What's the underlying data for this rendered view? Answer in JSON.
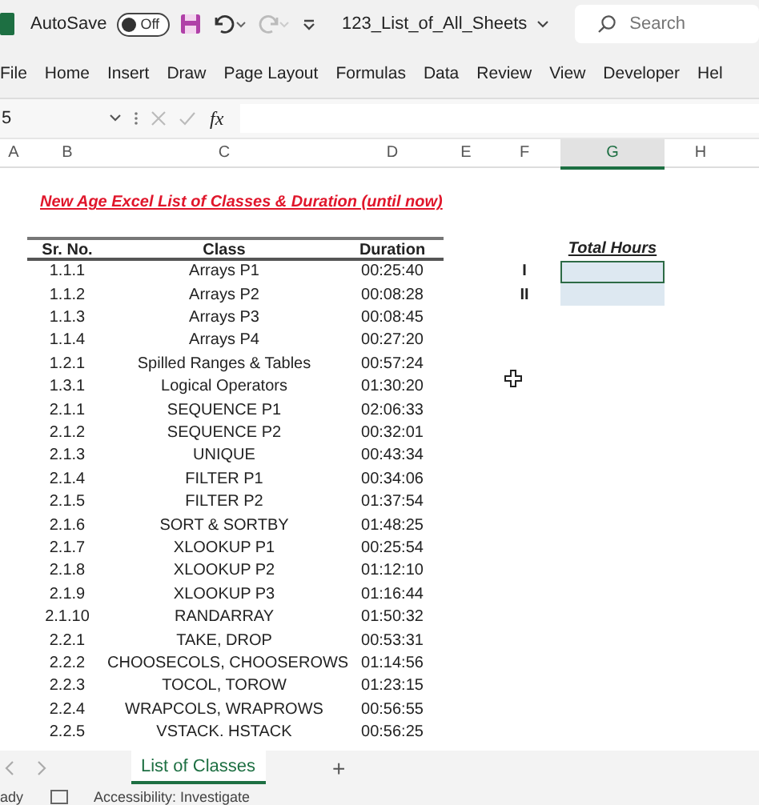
{
  "title_bar": {
    "autosave_label": "AutoSave",
    "autosave": {
      "on": false,
      "label": "Off"
    },
    "file_name": "123_List_of_All_Sheets",
    "search": {
      "placeholder": "Search"
    }
  },
  "ribbon_tabs": [
    "File",
    "Home",
    "Insert",
    "Draw",
    "Page Layout",
    "Formulas",
    "Data",
    "Review",
    "View",
    "Developer",
    "Hel"
  ],
  "formula_bar": {
    "name_box": "5",
    "fx": "fx"
  },
  "column_headers": [
    {
      "label": "A",
      "selected": false
    },
    {
      "label": "B",
      "selected": false
    },
    {
      "label": "C",
      "selected": false
    },
    {
      "label": "D",
      "selected": false
    },
    {
      "label": "E",
      "selected": false
    },
    {
      "label": "F",
      "selected": false
    },
    {
      "label": "G",
      "selected": true
    },
    {
      "label": "H",
      "selected": false
    }
  ],
  "sheet": {
    "title": "New Age Excel List of Classes & Duration (until now)",
    "table": {
      "columns": [
        "Sr. No.",
        "Class",
        "Duration"
      ],
      "rows": [
        [
          "1.1.1",
          "Arrays P1",
          "00:25:40"
        ],
        [
          "1.1.2",
          "Arrays P2",
          "00:08:28"
        ],
        [
          "1.1.3",
          "Arrays P3",
          "00:08:45"
        ],
        [
          "1.1.4",
          "Arrays P4",
          "00:27:20"
        ],
        [
          "1.2.1",
          "Spilled Ranges & Tables",
          "00:57:24"
        ],
        [
          "1.3.1",
          "Logical Operators",
          "01:30:20"
        ],
        [
          "2.1.1",
          "SEQUENCE P1",
          "02:06:33"
        ],
        [
          "2.1.2",
          "SEQUENCE P2",
          "00:32:01"
        ],
        [
          "2.1.3",
          "UNIQUE",
          "00:43:34"
        ],
        [
          "2.1.4",
          "FILTER P1",
          "00:34:06"
        ],
        [
          "2.1.5",
          "FILTER P2",
          "01:37:54"
        ],
        [
          "2.1.6",
          "SORT & SORTBY",
          "01:48:25"
        ],
        [
          "2.1.7",
          "XLOOKUP P1",
          "00:25:54"
        ],
        [
          "2.1.8",
          "XLOOKUP P2",
          "01:12:10"
        ],
        [
          "2.1.9",
          "XLOOKUP P3",
          "01:16:44"
        ],
        [
          "2.1.10",
          "RANDARRAY",
          "01:50:32"
        ],
        [
          "2.2.1",
          "TAKE, DROP",
          "00:53:31"
        ],
        [
          "2.2.2",
          "CHOOSECOLS, CHOOSEROWS",
          "01:14:56"
        ],
        [
          "2.2.3",
          "TOCOL, TOROW",
          "01:23:15"
        ],
        [
          "2.2.4",
          "WRAPCOLS, WRAPROWS",
          "00:56:55"
        ],
        [
          "2.2.5",
          "VSTACK. HSTACK",
          "00:56:25"
        ]
      ]
    },
    "total_hours": {
      "label": "Total Hours",
      "rows": [
        {
          "label": "I",
          "selected": true
        },
        {
          "label": "II",
          "selected": false
        }
      ]
    }
  },
  "sheet_tabs": [
    {
      "label": "List of Classes",
      "selected": true
    }
  ],
  "add_sheet": "+",
  "status_bar": {
    "mode": "ady",
    "accessibility": "Accessibility: Investigate"
  }
}
